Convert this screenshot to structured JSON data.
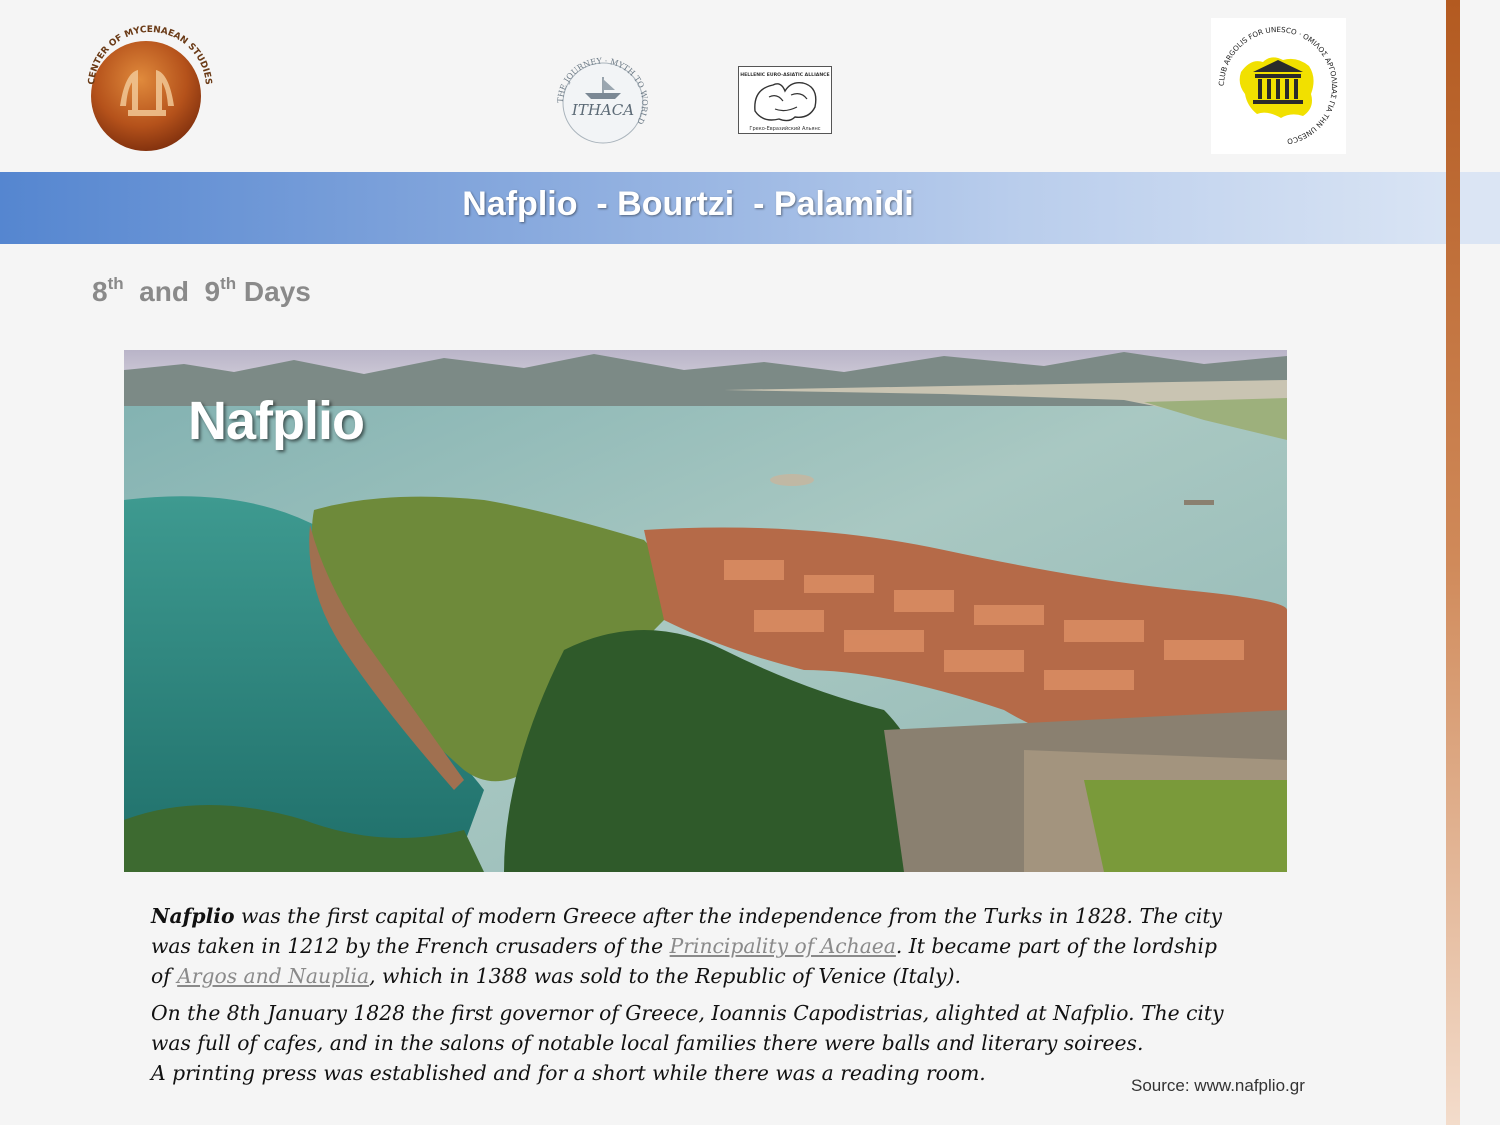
{
  "logos": {
    "left_ring_text": "CENTER OF MYCENAEAN STUDIES",
    "ithaca_main": "ITHACA",
    "ithaca_ring": "THE JOURNEY · MYTH TO WORLD",
    "alliance_top": "HELLENIC EURO-ASIATIC ALLIANCE",
    "alliance_bottom": "Греко-Евразийский Альянс",
    "unesco_ring": "CLUB ARGOLIS FOR UNESCO · ΟΜΙΛΟΣ ΑΡΓΟΛΙΔΑΣ ΓΙΑ ΤΗΝ UNESCO"
  },
  "banner": {
    "title": "Nafplio  - Bourtzi  - Palamidi"
  },
  "subtitle": {
    "n1": "8",
    "sup1": "th",
    "mid": "  and  ",
    "n2": "9",
    "sup2": "th",
    "tail": " Days"
  },
  "photo": {
    "label": "Nafplio"
  },
  "body": {
    "p1": {
      "bold": "Nafplio",
      "text1": " was the first capital of modern Greece after the independence from the Turks in 1828. The city was taken in 1212 by the French crusaders of the ",
      "link1": "Principality of Achaea",
      "text2": ". It became part of the lordship of ",
      "link2": "Argos and Nauplia",
      "text3": ", which in 1388 was sold to the Republic of Venice (Italy)."
    },
    "p2": {
      "line1": " On the 8th January 1828 the first governor of Greece, Ioannis Capodistrias, alighted at Nafplio. The city was full of cafes, and in the salons of notable local families there were balls and literary soirees.",
      "line2": "A printing press was established and for a short while there was a reading room."
    }
  },
  "source": "Source: www.nafplio.gr",
  "colors": {
    "banner": "#5586d0",
    "side_bar": "#b35a20",
    "link": "#8a8a8a"
  }
}
